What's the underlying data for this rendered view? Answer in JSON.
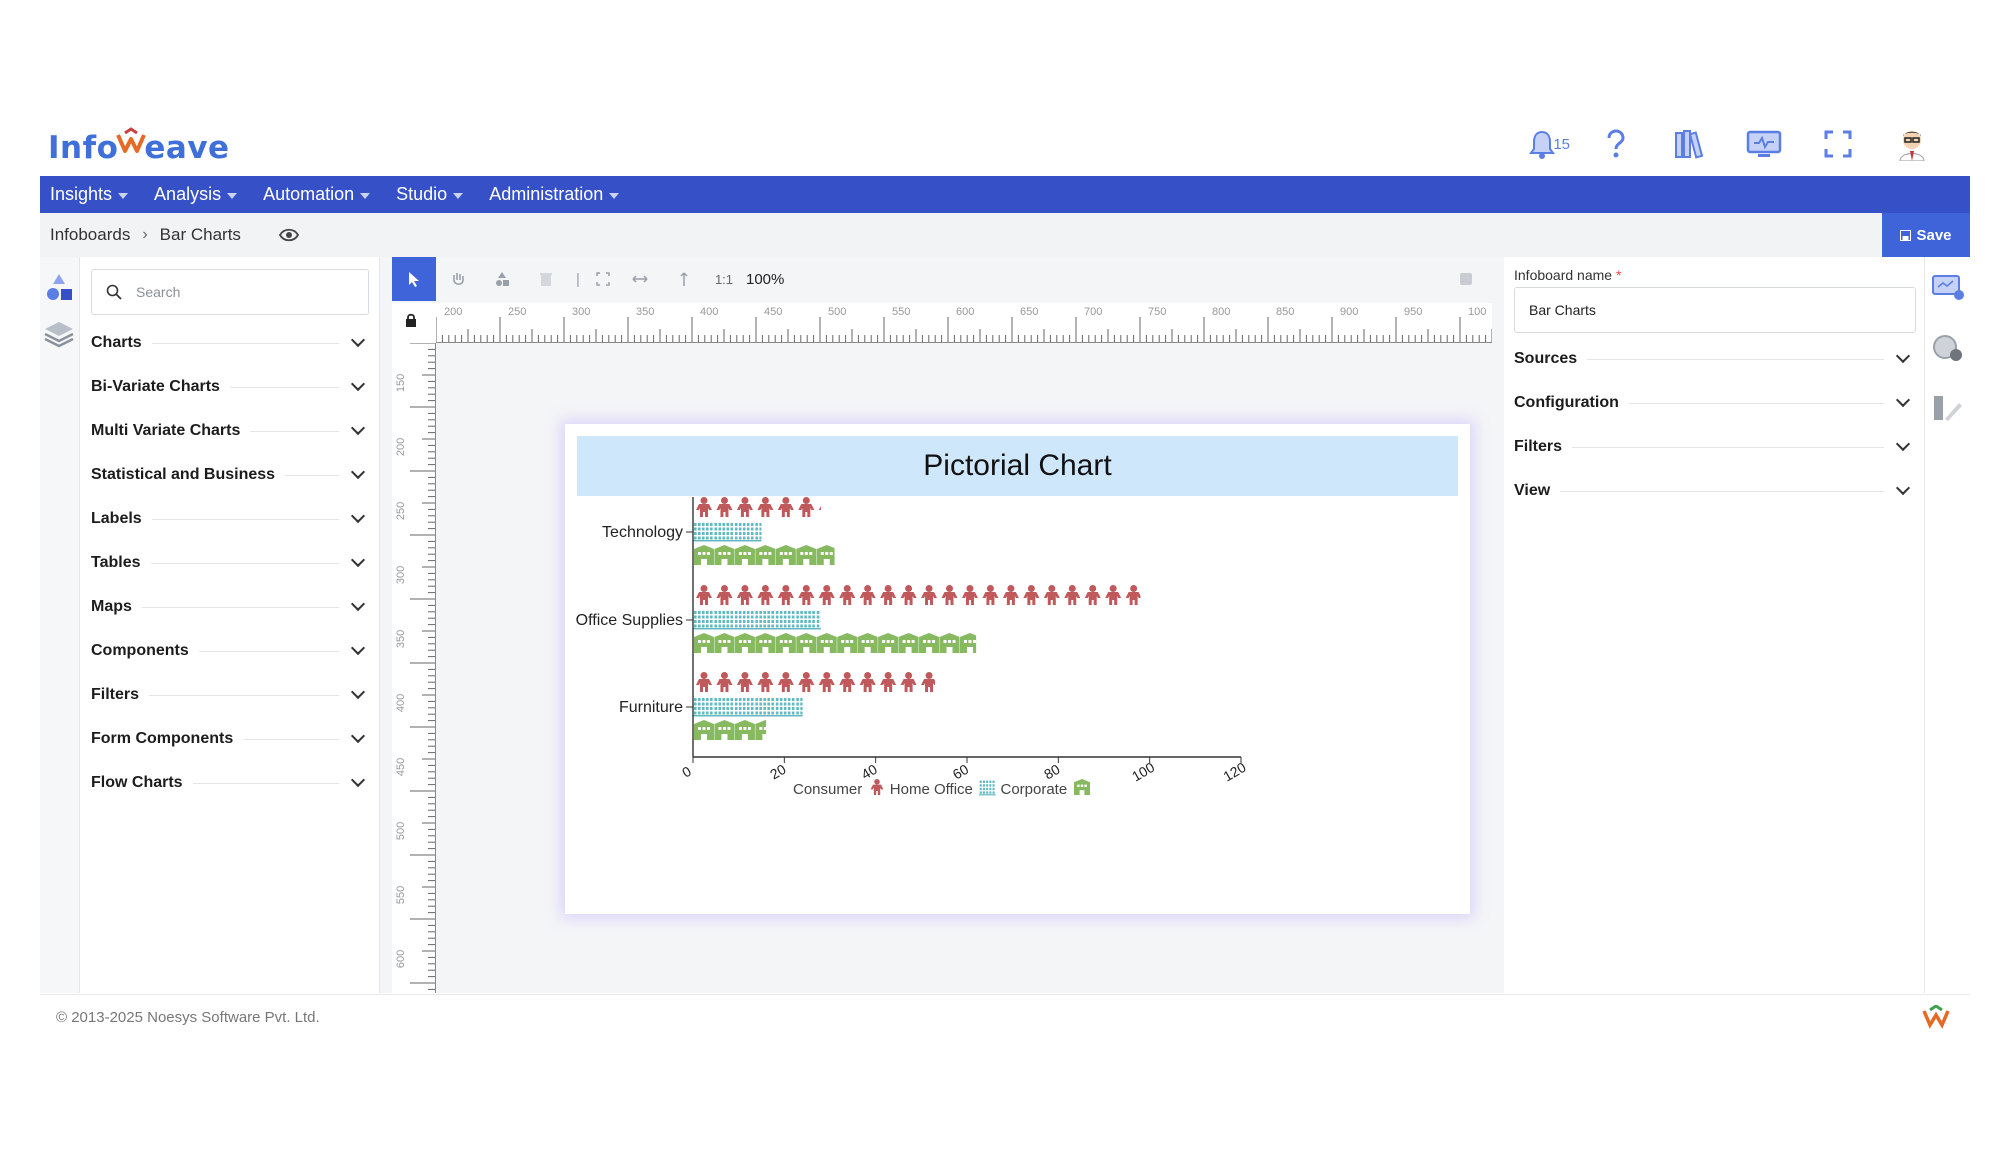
{
  "header": {
    "logo": {
      "part1": "Info",
      "part2": "eave"
    },
    "notification_count": "15",
    "icons": [
      "bell-icon",
      "help-icon",
      "library-icon",
      "monitor-icon",
      "fullscreen-icon",
      "user-avatar"
    ]
  },
  "nav": {
    "items": [
      {
        "label": "Insights"
      },
      {
        "label": "Analysis"
      },
      {
        "label": "Automation"
      },
      {
        "label": "Studio"
      },
      {
        "label": "Administration"
      }
    ]
  },
  "breadcrumb": {
    "root": "Infoboards",
    "current": "Bar Charts"
  },
  "toolbar": {
    "save_label": "Save",
    "ratio_label": "1:1",
    "zoom_label": "100%"
  },
  "widgets": {
    "search_placeholder": "Search",
    "categories": [
      {
        "label": "Charts"
      },
      {
        "label": "Bi-Variate Charts"
      },
      {
        "label": "Multi Variate Charts"
      },
      {
        "label": "Statistical and Business"
      },
      {
        "label": "Labels"
      },
      {
        "label": "Tables"
      },
      {
        "label": "Maps"
      },
      {
        "label": "Components"
      },
      {
        "label": "Filters"
      },
      {
        "label": "Form Components"
      },
      {
        "label": "Flow Charts"
      }
    ]
  },
  "rulers": {
    "top_labels": [
      "200",
      "250",
      "300",
      "350",
      "400",
      "450",
      "500",
      "550",
      "600",
      "650",
      "700",
      "750",
      "800",
      "850",
      "900",
      "950",
      "100"
    ],
    "left_labels": [
      "150",
      "200",
      "250",
      "300",
      "350",
      "400",
      "450",
      "500",
      "550",
      "600"
    ]
  },
  "properties": {
    "name_label": "Infoboard name",
    "name_value": "Bar Charts",
    "sections": [
      {
        "label": "Sources"
      },
      {
        "label": "Configuration"
      },
      {
        "label": "Filters"
      },
      {
        "label": "View"
      }
    ]
  },
  "colors": {
    "consumer": "#c0595b",
    "home_office": "#63b9c2",
    "corporate": "#86b960",
    "nav": "#3651c8",
    "accent": "#3f63d9"
  },
  "chart_data": {
    "type": "bar",
    "orientation": "horizontal",
    "style": "pictorial",
    "title": "Pictorial Chart",
    "categories": [
      "Technology",
      "Office Supplies",
      "Furniture"
    ],
    "series": [
      {
        "name": "Consumer",
        "icon": "person-icon",
        "values": [
          28,
          98,
          53
        ]
      },
      {
        "name": "Home Office",
        "icon": "building-icon",
        "values": [
          15,
          28,
          24
        ]
      },
      {
        "name": "Corporate",
        "icon": "house-icon",
        "values": [
          31,
          62,
          16
        ]
      }
    ],
    "xlim": [
      0,
      120
    ],
    "xticks": [
      "0",
      "20",
      "40",
      "60",
      "80",
      "100",
      "120"
    ],
    "legend": "bottom"
  },
  "footer": {
    "copyright": "© 2013-2025 Noesys Software Pvt. Ltd."
  }
}
